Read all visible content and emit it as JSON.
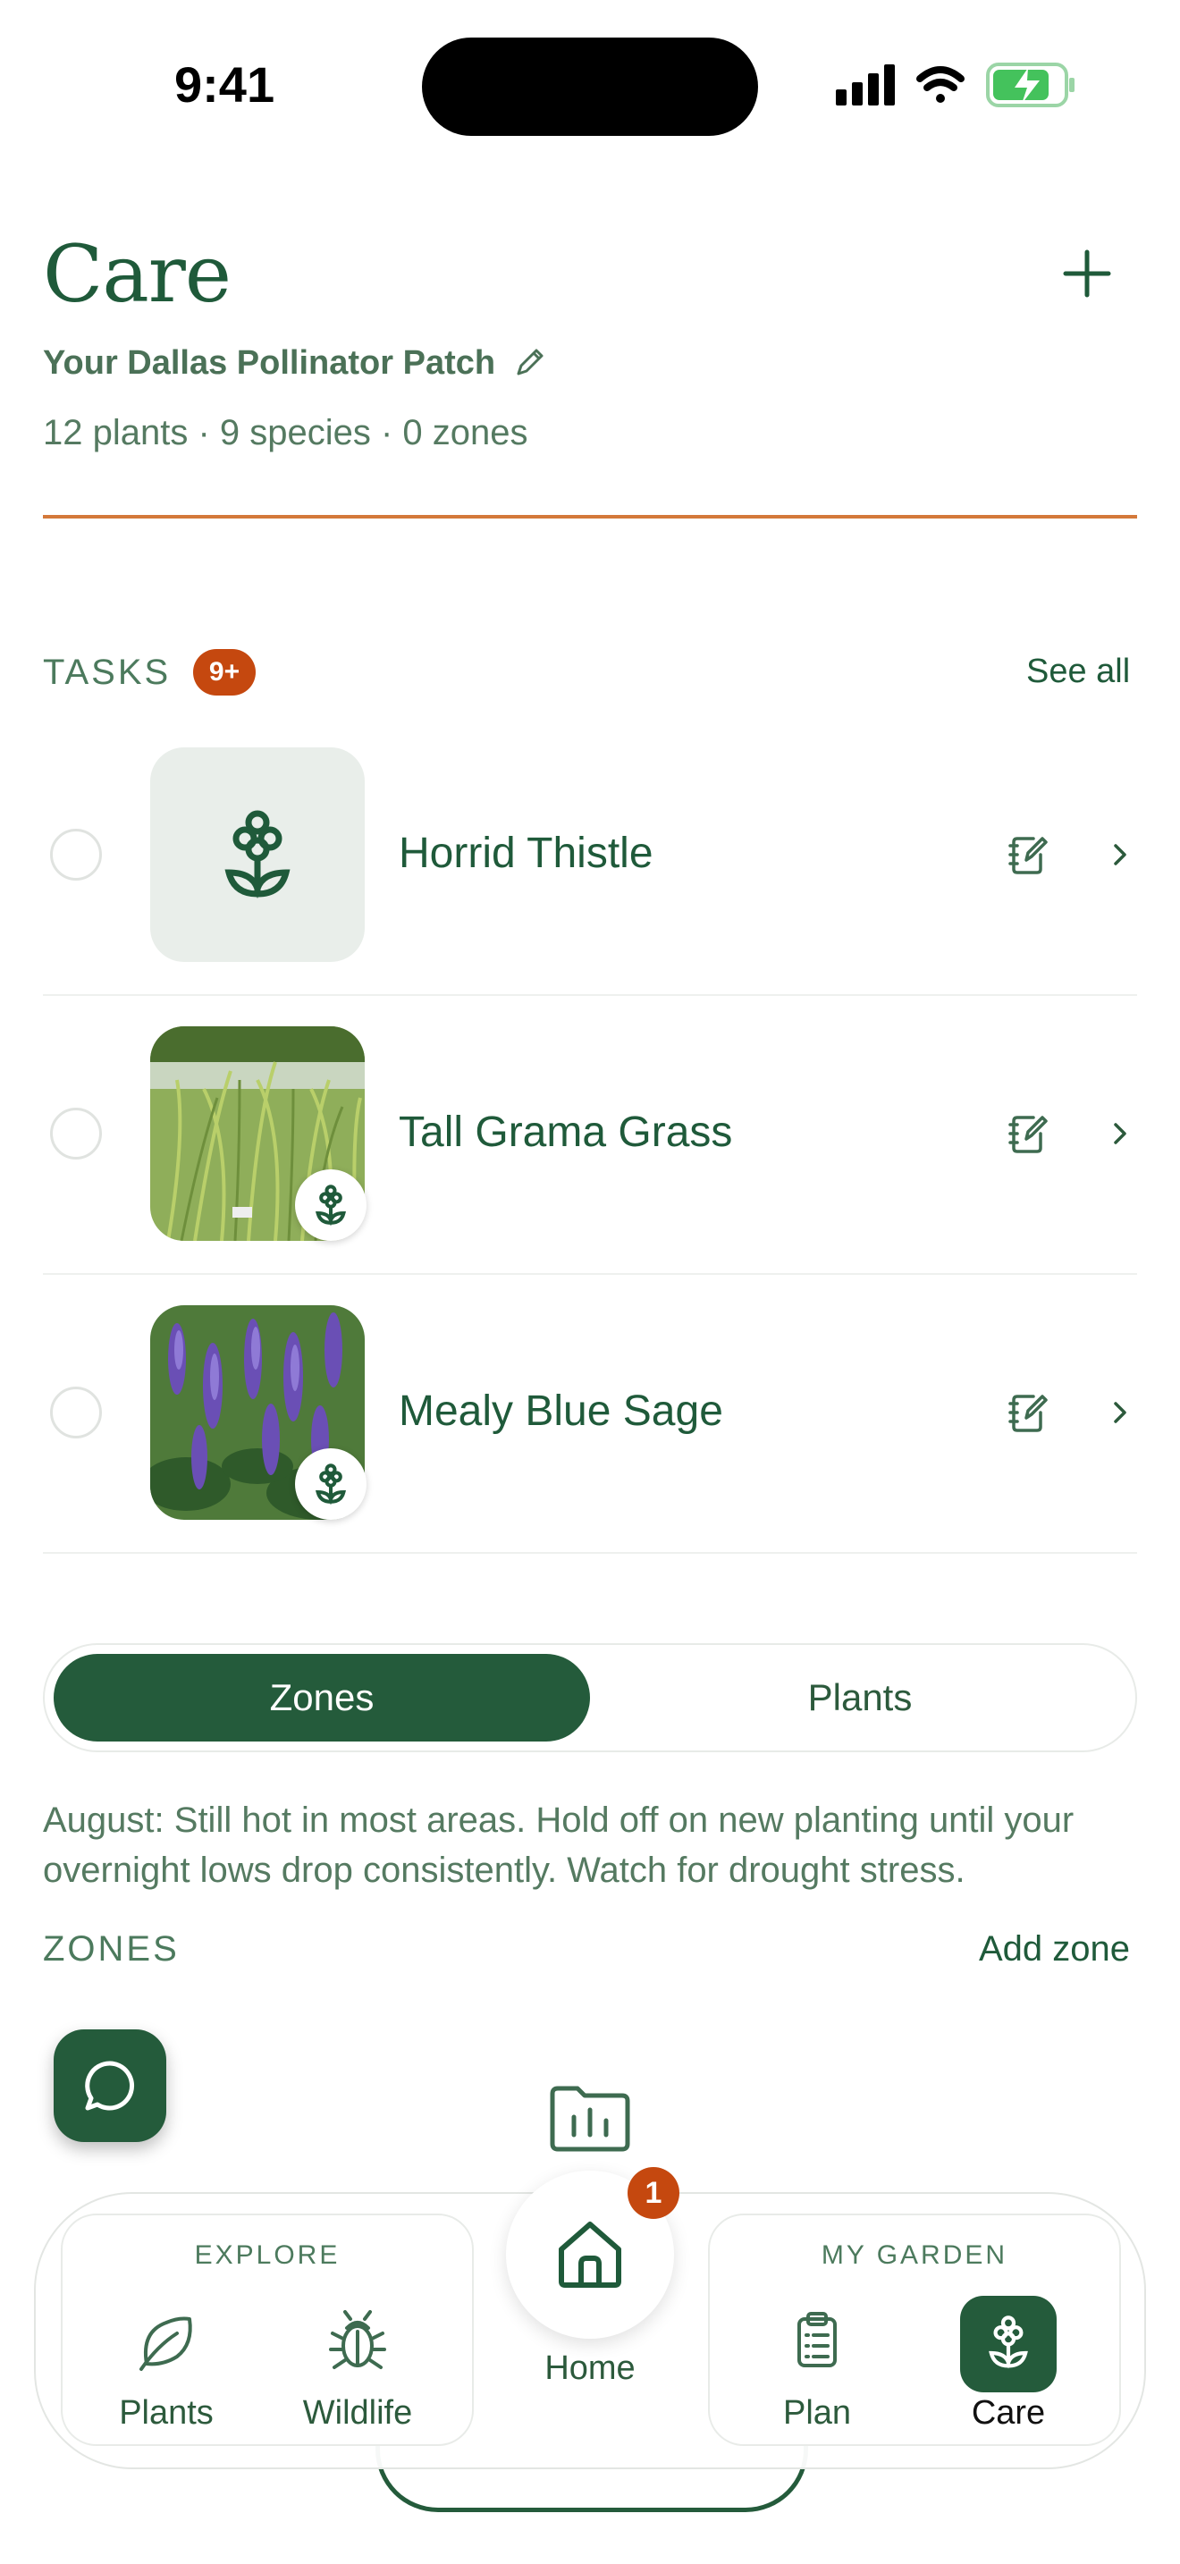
{
  "status_bar": {
    "time": "9:41"
  },
  "header": {
    "title": "Care",
    "garden_name": "Your Dallas Pollinator Patch",
    "stats": "12 plants · 9 species · 0 zones"
  },
  "tasks": {
    "label": "TASKS",
    "badge": "9+",
    "see_all": "See all",
    "items": [
      {
        "name": "Horrid Thistle"
      },
      {
        "name": "Tall Grama Grass"
      },
      {
        "name": "Mealy Blue Sage"
      }
    ]
  },
  "segment": {
    "zones_label": "Zones",
    "plants_label": "Plants",
    "selected": "Zones"
  },
  "advice": "August: Still hot in most areas. Hold off on new planting until your overnight lows drop consistently. Watch for drought stress.",
  "zones": {
    "label": "ZONES",
    "add_label": "Add zone"
  },
  "bottom_nav": {
    "explore_title": "EXPLORE",
    "explore_tabs": [
      "Plants",
      "Wildlife"
    ],
    "home_label": "Home",
    "home_badge": "1",
    "garden_title": "MY GARDEN",
    "garden_tabs": [
      "Plan",
      "Care"
    ],
    "active_tab": "Care"
  },
  "colors": {
    "primary": "#245b3b",
    "accent_orange": "#d4793a",
    "badge": "#c5480f"
  },
  "icons": [
    "add-icon",
    "pencil-icon",
    "flower-icon",
    "note-edit-icon",
    "chevron-right-icon",
    "chat-icon",
    "folder-chart-icon",
    "leaf-icon",
    "bug-icon",
    "home-icon",
    "clipboard-icon"
  ]
}
